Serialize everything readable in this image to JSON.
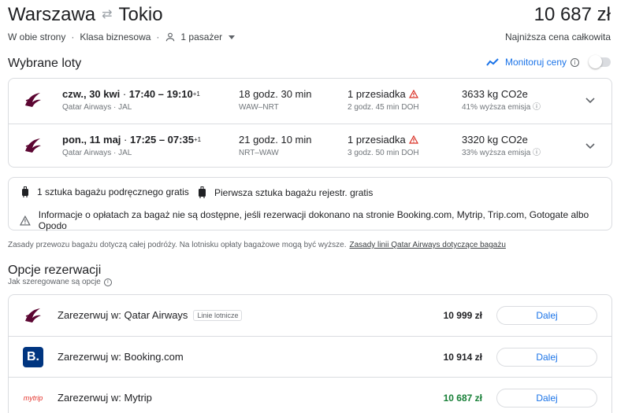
{
  "header": {
    "origin": "Warszawa",
    "destination": "Tokio",
    "trip_type": "W obie strony",
    "cabin": "Klasa biznesowa",
    "passengers": "1 pasażer",
    "total_price": "10 687 zł",
    "price_label": "Najniższa cena całkowita"
  },
  "selected": {
    "title": "Wybrane loty",
    "track_label": "Monitoruj ceny"
  },
  "flights": [
    {
      "date_times": "czw., 30 kwi",
      "times": "17:40 – 19:10",
      "plus_days": "+1",
      "airlines": "Qatar Airways · JAL",
      "duration": "18 godz. 30 min",
      "route": "WAW–NRT",
      "stops": "1 przesiadka",
      "layover": "2 godz. 45 min DOH",
      "emissions": "3633 kg CO2e",
      "emissions_note": "41% wyższa emisja"
    },
    {
      "date_times": "pon., 11 maj",
      "times": "17:25 – 07:35",
      "plus_days": "+1",
      "airlines": "Qatar Airways · JAL",
      "duration": "21 godz. 10 min",
      "route": "NRT–WAW",
      "stops": "1 przesiadka",
      "layover": "3 godz. 50 min DOH",
      "emissions": "3320 kg CO2e",
      "emissions_note": "33% wyższa emisja"
    }
  ],
  "baggage": {
    "carry_on": "1 sztuka bagażu podręcznego gratis",
    "checked": "Pierwsza sztuka bagażu rejestr. gratis",
    "notice": "Informacje o opłatach za bagaż nie są dostępne, jeśli rezerwacji dokonano na stronie Booking.com, Mytrip, Trip.com, Gotogate albo Opodo",
    "rules": "Zasady przewozu bagażu dotyczą całej podróży. Na lotnisku opłaty bagażowe mogą być wyższe.",
    "rules_link": "Zasady linii Qatar Airways dotyczące bagażu"
  },
  "options": {
    "title": "Opcje rezerwacji",
    "subtitle": "Jak szeregowane są opcje",
    "items": [
      {
        "name": "Zarezerwuj w: Qatar Airways",
        "badge": "Linie lotnicze",
        "price": "10 999 zł",
        "button": "Dalej"
      },
      {
        "name": "Zarezerwuj w: Booking.com",
        "logo_text": "B.",
        "price": "10 914 zł",
        "button": "Dalej"
      },
      {
        "name": "Zarezerwuj w: Mytrip",
        "logo_text": "mytrip",
        "price": "10 687 zł",
        "button": "Dalej"
      }
    ]
  },
  "colors": {
    "accent": "#1a73e8",
    "best_price": "#188038",
    "qatar": "#5c0632",
    "booking": "#003580"
  }
}
